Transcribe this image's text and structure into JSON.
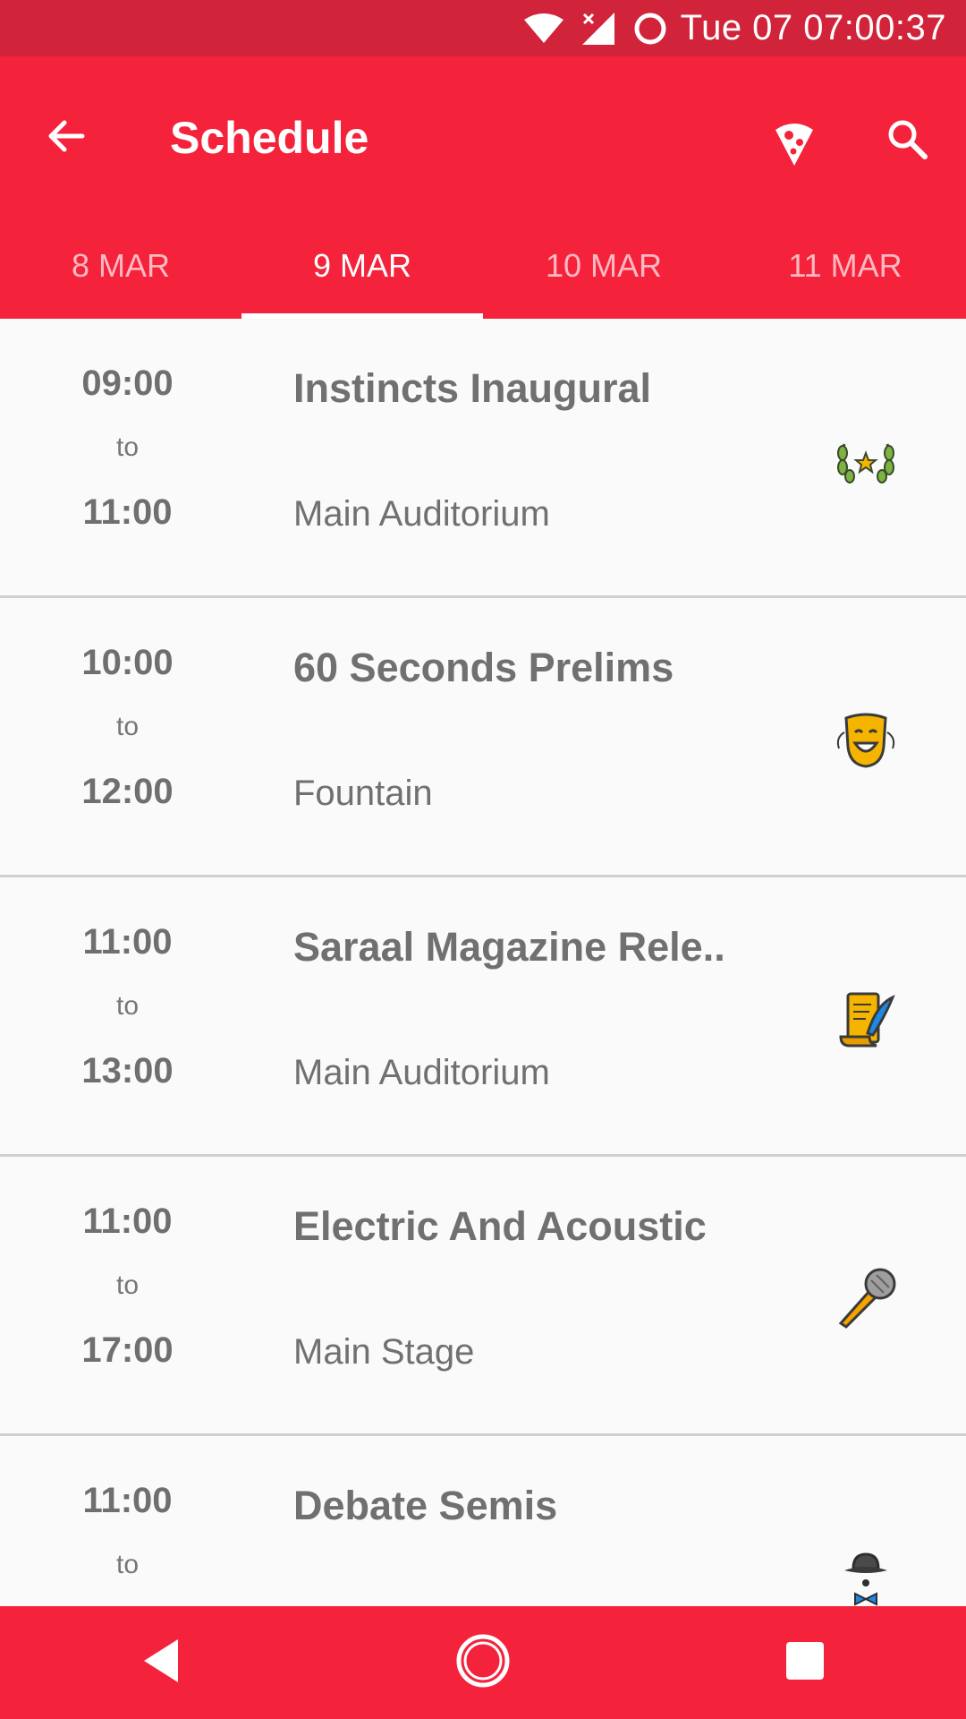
{
  "status_bar": {
    "time": "Tue 07 07:00:37",
    "icons": [
      "wifi-icon",
      "signal-icon",
      "sync-icon"
    ]
  },
  "app_bar": {
    "title": "Schedule",
    "icons": [
      "back-arrow-icon",
      "pizza-icon",
      "search-icon"
    ],
    "accent_color": "#f5223c"
  },
  "tabs": [
    {
      "label": "8 MAR",
      "active": false
    },
    {
      "label": "9 MAR",
      "active": true
    },
    {
      "label": "10 MAR",
      "active": false
    },
    {
      "label": "11 MAR",
      "active": false
    }
  ],
  "events": [
    {
      "start": "09:00",
      "to": "to",
      "end": "11:00",
      "title": "Instincts Inaugural",
      "venue": "Main Auditorium",
      "icon": "laurel-star-icon"
    },
    {
      "start": "10:00",
      "to": "to",
      "end": "12:00",
      "title": "60 Seconds Prelims",
      "venue": "Fountain",
      "icon": "theater-mask-icon"
    },
    {
      "start": "11:00",
      "to": "to",
      "end": "13:00",
      "title": "Saraal Magazine Rele..",
      "venue": "Main Auditorium",
      "icon": "scroll-quill-icon"
    },
    {
      "start": "11:00",
      "to": "to",
      "end": "17:00",
      "title": "Electric And Acoustic",
      "venue": "Main Stage",
      "icon": "microphone-icon"
    },
    {
      "start": "11:00",
      "to": "to",
      "end": "",
      "title": "Debate Semis",
      "venue": "",
      "icon": "bowler-hat-bowtie-icon"
    }
  ],
  "nav_bar": {
    "icons": [
      "nav-back-icon",
      "nav-home-icon",
      "nav-recents-icon"
    ]
  }
}
